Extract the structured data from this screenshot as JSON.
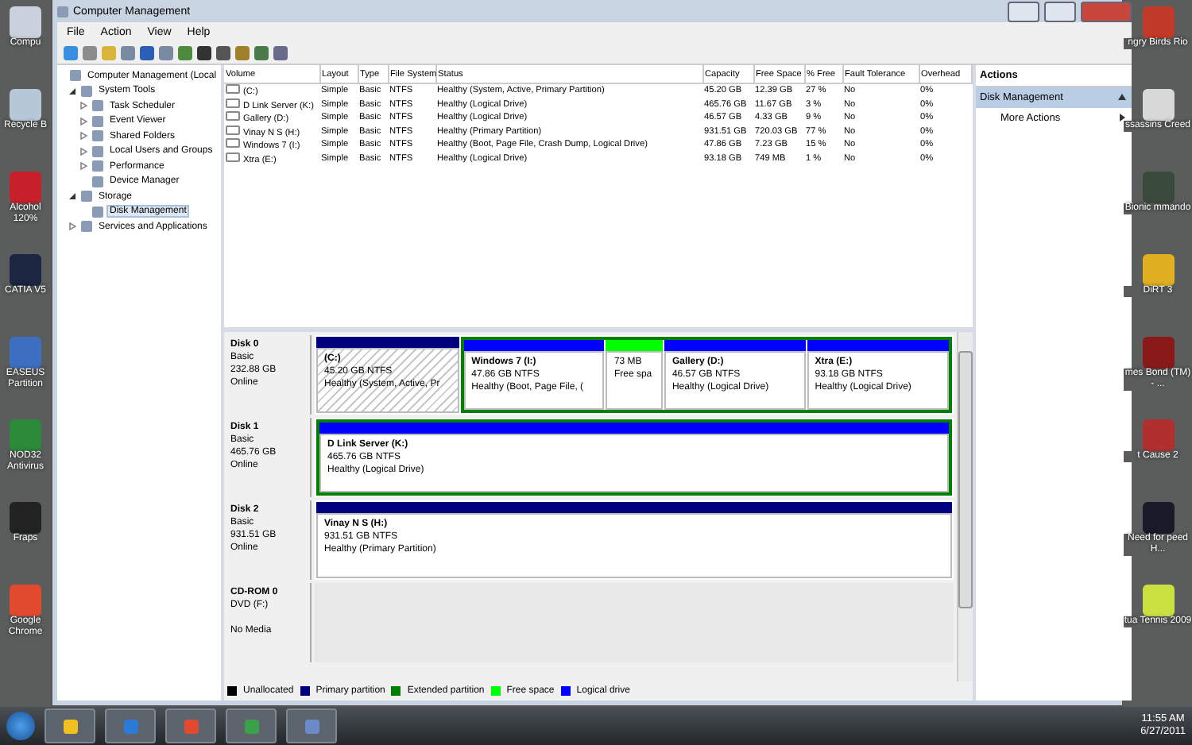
{
  "window": {
    "title": "Computer Management"
  },
  "menu": [
    "File",
    "Action",
    "View",
    "Help"
  ],
  "tree": [
    {
      "label": "Computer Management (Local",
      "selected": false,
      "children": [
        {
          "label": "System Tools",
          "expanded": true,
          "selected": false,
          "children": [
            {
              "label": "Task Scheduler",
              "expanded": false,
              "selected": false
            },
            {
              "label": "Event Viewer",
              "expanded": false,
              "selected": false
            },
            {
              "label": "Shared Folders",
              "expanded": false,
              "selected": false
            },
            {
              "label": "Local Users and Groups",
              "expanded": false,
              "selected": false
            },
            {
              "label": "Performance",
              "expanded": false,
              "selected": false
            },
            {
              "label": "Device Manager",
              "selected": false
            }
          ]
        },
        {
          "label": "Storage",
          "expanded": true,
          "selected": false,
          "children": [
            {
              "label": "Disk Management",
              "selected": true
            }
          ]
        },
        {
          "label": "Services and Applications",
          "expanded": false,
          "selected": false
        }
      ]
    }
  ],
  "table": {
    "columns": [
      "Volume",
      "Layout",
      "Type",
      "File System",
      "Status",
      "Capacity",
      "Free Space",
      "% Free",
      "Fault Tolerance",
      "Overhead"
    ],
    "rows": [
      [
        "(C:)",
        "Simple",
        "Basic",
        "NTFS",
        "Healthy (System, Active, Primary Partition)",
        "45.20 GB",
        "12.39 GB",
        "27 %",
        "No",
        "0%"
      ],
      [
        "D Link Server (K:)",
        "Simple",
        "Basic",
        "NTFS",
        "Healthy (Logical Drive)",
        "465.76 GB",
        "11.67 GB",
        "3 %",
        "No",
        "0%"
      ],
      [
        "Gallery (D:)",
        "Simple",
        "Basic",
        "NTFS",
        "Healthy (Logical Drive)",
        "46.57 GB",
        "4.33 GB",
        "9 %",
        "No",
        "0%"
      ],
      [
        "Vinay N S (H:)",
        "Simple",
        "Basic",
        "NTFS",
        "Healthy (Primary Partition)",
        "931.51 GB",
        "720.03 GB",
        "77 %",
        "No",
        "0%"
      ],
      [
        "Windows 7 (I:)",
        "Simple",
        "Basic",
        "NTFS",
        "Healthy (Boot, Page File, Crash Dump, Logical Drive)",
        "47.86 GB",
        "7.23 GB",
        "15 %",
        "No",
        "0%"
      ],
      [
        "Xtra (E:)",
        "Simple",
        "Basic",
        "NTFS",
        "Healthy (Logical Drive)",
        "93.18 GB",
        "749 MB",
        "1 %",
        "No",
        "0%"
      ]
    ]
  },
  "disks": [
    {
      "kind": "disk",
      "name": "Disk 0",
      "type": "Basic",
      "size": "232.88 GB",
      "status": "Online",
      "parts": [
        {
          "kind": "primary",
          "name": "(C:)",
          "size": "45.20 GB NTFS",
          "status": "Healthy (System, Active, Pr",
          "selected": true
        },
        {
          "kind": "extended",
          "children": [
            {
              "kind": "logical",
              "name": "Windows 7  (I:)",
              "size": "47.86 GB NTFS",
              "status": "Healthy (Boot, Page File, (",
              "selected": false
            },
            {
              "kind": "free",
              "size": "73 MB",
              "status": "Free spa",
              "selected": false
            },
            {
              "kind": "logical",
              "name": "Gallery  (D:)",
              "size": "46.57 GB NTFS",
              "status": "Healthy (Logical Drive)",
              "selected": false
            },
            {
              "kind": "logical",
              "name": "Xtra  (E:)",
              "size": "93.18 GB NTFS",
              "status": "Healthy (Logical Drive)",
              "selected": false
            }
          ]
        }
      ]
    },
    {
      "kind": "disk",
      "name": "Disk 1",
      "type": "Basic",
      "size": "465.76 GB",
      "status": "Online",
      "parts": [
        {
          "kind": "extended",
          "children": [
            {
              "kind": "logical",
              "name": "D Link Server  (K:)",
              "size": "465.76 GB NTFS",
              "status": "Healthy (Logical Drive)",
              "selected": false
            }
          ]
        }
      ]
    },
    {
      "kind": "disk",
      "name": "Disk 2",
      "type": "Basic",
      "size": "931.51 GB",
      "status": "Online",
      "parts": [
        {
          "kind": "primary",
          "name": "Vinay N S  (H:)",
          "size": "931.51 GB NTFS",
          "status": "Healthy (Primary Partition)",
          "selected": false
        }
      ]
    },
    {
      "kind": "cdrom",
      "name": "CD-ROM 0",
      "type": "DVD (F:)",
      "status": "No Media"
    }
  ],
  "legend": [
    {
      "label": "Unallocated",
      "color": "#000000"
    },
    {
      "label": "Primary partition",
      "color": "#00007f"
    },
    {
      "label": "Extended partition",
      "color": "#007f00"
    },
    {
      "label": "Free space",
      "color": "#00ff00"
    },
    {
      "label": "Logical drive",
      "color": "#0000ff"
    }
  ],
  "actions": {
    "title": "Actions",
    "section": "Disk Management",
    "items": [
      "More Actions"
    ]
  },
  "desktop_left": [
    "Compu",
    "Recycle B",
    "Alcohol 120%",
    "CATIA V5",
    "EASEUS Partition",
    "NOD32 Antivirus",
    "Fraps",
    "Google Chrome"
  ],
  "desktop_right": [
    "ngry Birds Rio",
    "ssassins Creed",
    "Bionic mmando",
    "DiRT 3",
    "mes Bond (TM) - ...",
    "t Cause 2",
    "Need for peed H...",
    "tua Tennis 2009"
  ],
  "clock": {
    "time": "11:55 AM",
    "date": "6/27/2011"
  }
}
